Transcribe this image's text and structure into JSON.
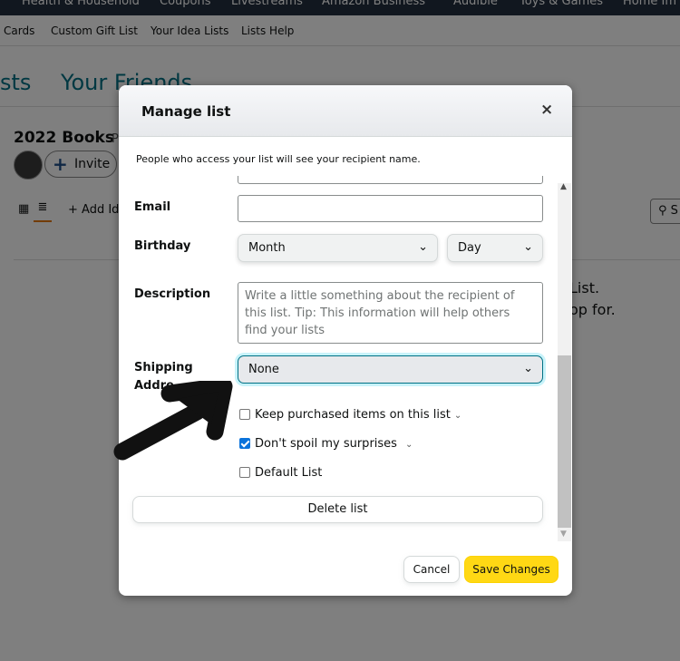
{
  "topnav": [
    "Health & Household",
    "Coupons",
    "Livestreams",
    "Amazon Business",
    "Audible",
    "Toys & Games",
    "Home Im"
  ],
  "subnav": [
    "Cards",
    "Custom Gift List",
    "Your Idea Lists",
    "Lists Help"
  ],
  "page_tabs": [
    "sts",
    "Your Friends"
  ],
  "list": {
    "title": "2022 Books",
    "privacy_initial": "P",
    "invite_label": "Invite",
    "add_idea_label": "+ Add Ide",
    "search_label": "S",
    "empty_msg_line1": "List.",
    "empty_msg_line2": "op for."
  },
  "modal": {
    "title": "Manage list",
    "close_glyph": "×",
    "notice": "People who access your list will see your recipient name.",
    "fields": {
      "email_label": "Email",
      "birthday_label": "Birthday",
      "birthday_month": "Month",
      "birthday_day": "Day",
      "description_label": "Description",
      "description_placeholder": "Write a little something about the recipient of this list. Tip: This information will help others find your lists",
      "shipping_label_line1": "Shipping",
      "shipping_label_line2": "Addre",
      "shipping_value": "None"
    },
    "checkboxes": [
      {
        "label": "Keep purchased items on this list",
        "checked": false
      },
      {
        "label": "Don't spoil my surprises",
        "checked": true
      },
      {
        "label": "Default List",
        "checked": false
      }
    ],
    "delete_label": "Delete list",
    "cancel_label": "Cancel",
    "save_label": "Save Changes"
  },
  "colors": {
    "accent": "#007185",
    "save": "#ffd814",
    "checkbox": "#0b73db",
    "annotation_arrow": "#111111"
  }
}
